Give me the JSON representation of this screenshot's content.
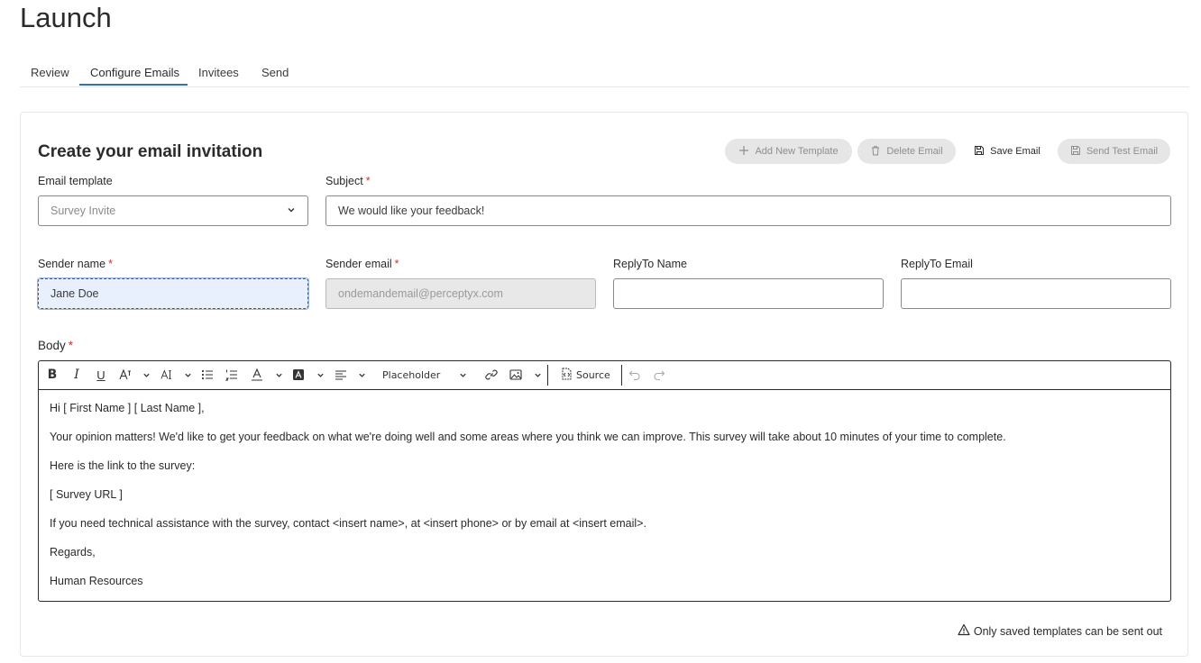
{
  "page": {
    "title": "Launch"
  },
  "tabs": [
    {
      "label": "Review"
    },
    {
      "label": "Configure Emails",
      "active": true
    },
    {
      "label": "Invitees"
    },
    {
      "label": "Send"
    }
  ],
  "card": {
    "title": "Create your email invitation",
    "actions": {
      "add_template": "Add New Template",
      "delete_email": "Delete Email",
      "save_email": "Save Email",
      "send_test": "Send Test Email"
    },
    "fields": {
      "email_template": {
        "label": "Email template",
        "value": "Survey Invite"
      },
      "subject": {
        "label": "Subject",
        "required_mark": "*",
        "value": "We would like your feedback!"
      },
      "sender_name": {
        "label": "Sender name",
        "required_mark": "*",
        "value": "Jane Doe"
      },
      "sender_email": {
        "label": "Sender email",
        "required_mark": "*",
        "value": "ondemandemail@perceptyx.com"
      },
      "reply_to_name": {
        "label": "ReplyTo Name",
        "value": ""
      },
      "reply_to_email": {
        "label": "ReplyTo Email",
        "value": ""
      }
    },
    "body": {
      "label": "Body",
      "required_mark": "*",
      "toolbar": {
        "placeholder_label": "Placeholder",
        "source_label": "Source"
      },
      "lines": [
        "Hi [ First Name ] [ Last Name ],",
        "Your opinion matters! We'd like to get your feedback on what we're doing well and some areas where you think we can improve. This survey will take about 10 minutes of your time to complete.",
        "Here is the link to the survey:",
        "[ Survey URL ]",
        "If you need technical assistance with the survey, contact <insert name>, at <insert phone> or by email at <insert email>.",
        "Regards,",
        "Human Resources"
      ]
    },
    "footer_note": "Only saved templates can be sent out"
  },
  "colors": {
    "accent": "#3a6fb8",
    "required": "#d0342c",
    "focus_bg": "#e8f0fd"
  }
}
